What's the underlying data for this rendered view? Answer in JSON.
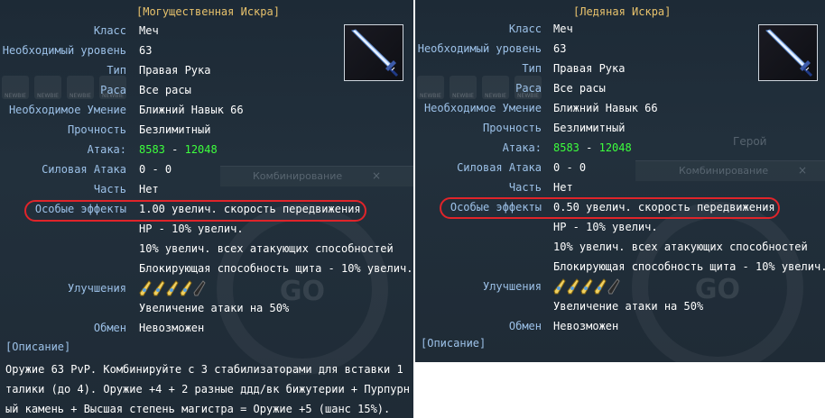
{
  "left": {
    "title": "[Могущественная Искра]",
    "rows": [
      {
        "label": "Класс",
        "value": "Меч"
      },
      {
        "label": "Необходимый уровень",
        "value": "63"
      },
      {
        "label": "Тип",
        "value": "Правая Рука"
      },
      {
        "label": "Раса",
        "value": "Все расы"
      },
      {
        "label": "Необходимое Умение",
        "value": "Ближний Навык 66"
      },
      {
        "label": "Прочность",
        "value": "Безлимитный"
      },
      {
        "label": "Атака:",
        "atk_min": "8583",
        "atk_sep": "-",
        "atk_max": "12048"
      },
      {
        "label": "Силовая Атака",
        "value": "0 - 0"
      },
      {
        "label": "Часть",
        "value": "Нет"
      },
      {
        "label": "Особые эффекты",
        "value": "1.00 увелич. скорость передвижения"
      },
      {
        "label": "",
        "value": "HP - 10% увелич."
      },
      {
        "label": "",
        "value": "10% увелич. всех атакующих способностей"
      },
      {
        "label": "",
        "value": "Блокирующая способность щита - 10% увелич."
      },
      {
        "label": "Улучшения",
        "upgrades_filled": 4,
        "upgrades_total": 5
      },
      {
        "label": "",
        "value": "Увеличение атаки на 50%"
      },
      {
        "label": "Обмен",
        "value": "Невозможен"
      }
    ],
    "description_header": "[Описание]",
    "description": "Оружие 63 PvP. Комбинируйте с 3 стабилизаторами для вставки 1 талики (до 4). Оружие +4 + 2 разные ддд/вк бижутерии + Пурпурный камень + Высшая степень магистра = Оружие +5 (шанс 15%).",
    "background": {
      "window_title": "Комбинирование",
      "close": "×",
      "go": "GO",
      "badges": [
        "NEWBIE",
        "NEWBIE",
        "NEWBIE",
        "NEWBIE"
      ]
    }
  },
  "right": {
    "title": "[Ледяная Искра]",
    "rows": [
      {
        "label": "Класс",
        "value": "Меч"
      },
      {
        "label": "Необходимый уровень",
        "value": "63"
      },
      {
        "label": "Тип",
        "value": "Правая Рука"
      },
      {
        "label": "Раса",
        "value": "Все расы"
      },
      {
        "label": "Необходимое Умение",
        "value": "Ближний Навык 66"
      },
      {
        "label": "Прочность",
        "value": "Безлимитный"
      },
      {
        "label": "Атака:",
        "atk_min": "8583",
        "atk_sep": "-",
        "atk_max": "12048"
      },
      {
        "label": "Силовая Атака",
        "value": "0 - 0"
      },
      {
        "label": "Часть",
        "value": "Нет"
      },
      {
        "label": "Особые эффекты",
        "value": "0.50 увелич. скорость передвижения"
      },
      {
        "label": "",
        "value": "HP - 10% увелич."
      },
      {
        "label": "",
        "value": "10% увелич. всех атакующих способностей"
      },
      {
        "label": "",
        "value": "Блокирующая способность щита - 10% увелич."
      },
      {
        "label": "Улучшения",
        "upgrades_filled": 4,
        "upgrades_total": 5
      },
      {
        "label": "",
        "value": "Увеличение атаки на 50%"
      },
      {
        "label": "Обмен",
        "value": "Невозможен"
      }
    ],
    "description_header": "[Описание]",
    "background": {
      "window_title": "Комбинирование",
      "close": "×",
      "go": "GO",
      "hero": "Герой",
      "badges": [
        "NEWBIE",
        "NEWBIE",
        "NEWBIE",
        "NEWBIE"
      ]
    }
  },
  "colors": {
    "label": "#9cc1e8",
    "value": "#ffffff",
    "title": "#e8c26c",
    "attack": "#3dff3d",
    "highlight": "#e0242a"
  }
}
